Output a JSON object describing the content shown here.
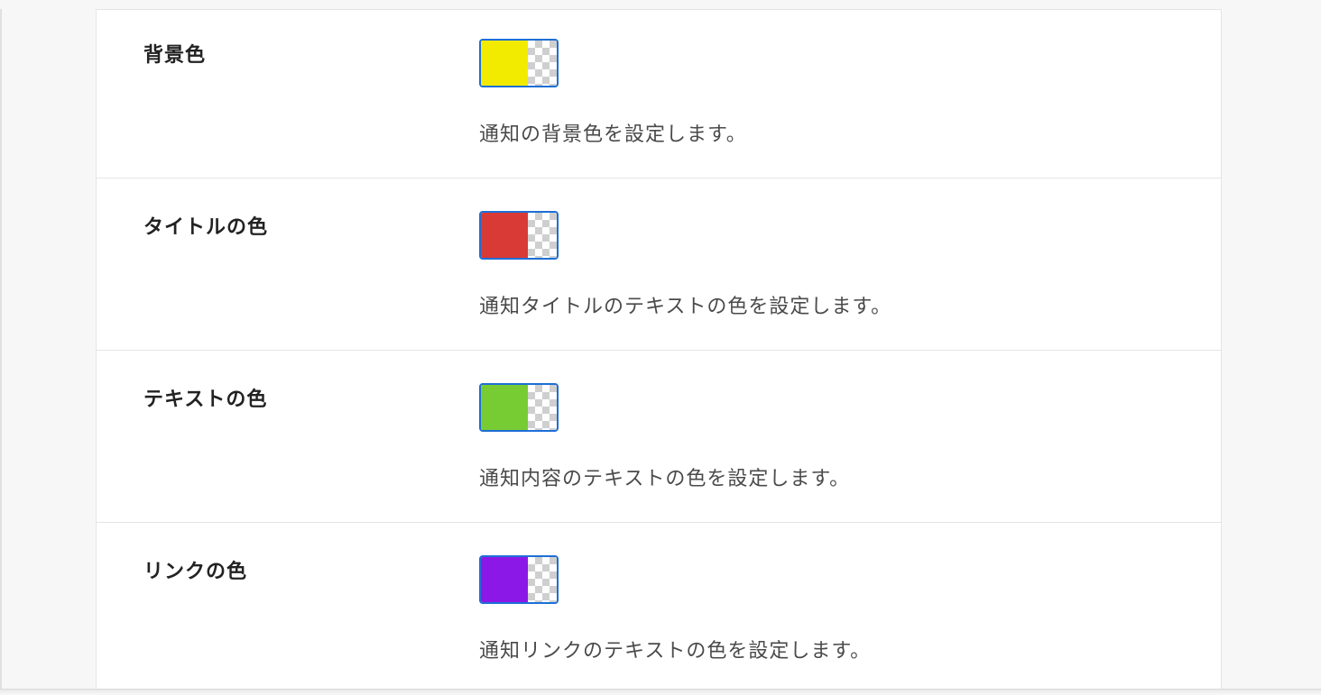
{
  "settings": {
    "background": {
      "label": "背景色",
      "description": "通知の背景色を設定します。",
      "color": "#f2eb00"
    },
    "title": {
      "label": "タイトルの色",
      "description": "通知タイトルのテキストの色を設定します。",
      "color": "#d93a36"
    },
    "text": {
      "label": "テキストの色",
      "description": "通知内容のテキストの色を設定します。",
      "color": "#78cc33"
    },
    "link": {
      "label": "リンクの色",
      "description": "通知リンクのテキストの色を設定します。",
      "color": "#8b18e6"
    }
  }
}
